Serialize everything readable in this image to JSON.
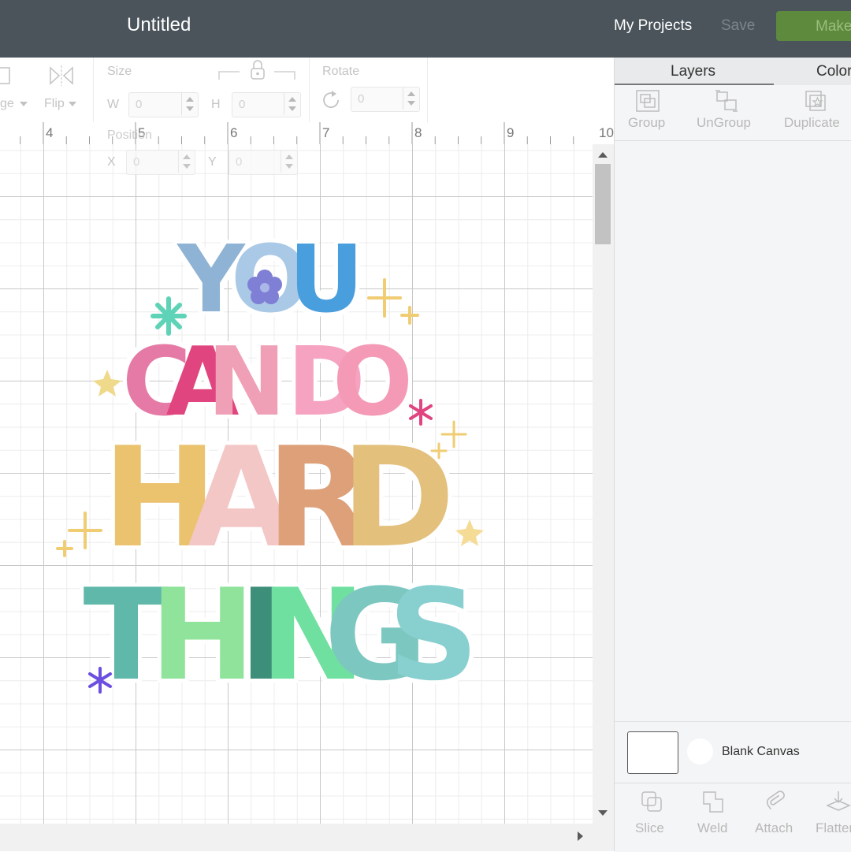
{
  "header": {
    "title": "Untitled",
    "my_projects": "My Projects",
    "save": "Save",
    "make": "Make"
  },
  "toolbar": {
    "arrange_label": "ge",
    "flip_label": "Flip",
    "size_label": "Size",
    "w_label": "W",
    "h_label": "H",
    "w_value": "0",
    "h_value": "0",
    "rotate_label": "Rotate",
    "rotate_value": "0",
    "position_label": "Position",
    "x_label": "X",
    "y_label": "Y",
    "x_value": "0",
    "y_value": "0"
  },
  "ruler": {
    "ticks": [
      "4",
      "5",
      "6",
      "7",
      "8",
      "9",
      "10"
    ]
  },
  "design": {
    "lines": [
      "YOU",
      "CAN DO",
      "HARD",
      "THINGS"
    ]
  },
  "panel": {
    "tabs": [
      "Layers",
      "Color"
    ],
    "top_tools": [
      "Group",
      "UnGroup",
      "Duplicate"
    ],
    "blank_canvas": "Blank Canvas",
    "bottom_tools": [
      "Slice",
      "Weld",
      "Attach",
      "Flatten"
    ]
  }
}
